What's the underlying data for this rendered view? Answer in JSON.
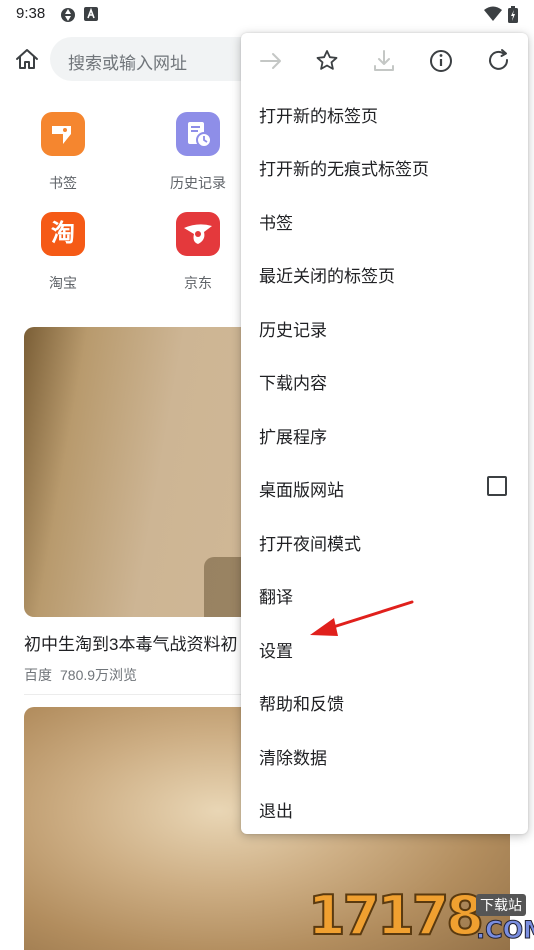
{
  "status_bar": {
    "time": "9:38",
    "icons": [
      "sync-icon",
      "a-box-icon",
      "wifi-icon",
      "battery-icon"
    ]
  },
  "omnibox": {
    "placeholder": "搜索或输入网址"
  },
  "shortcuts": [
    {
      "label": "书签",
      "icon": "bookmark-tile-icon",
      "color": "#f5862f"
    },
    {
      "label": "历史记录",
      "icon": "history-tile-icon",
      "color": "#8e8ee8"
    },
    {
      "label": "淘宝",
      "icon": "taobao-tile-icon",
      "color": "#f55a16",
      "glyph": "淘"
    },
    {
      "label": "京东",
      "icon": "jd-tile-icon",
      "color": "#e4393c"
    }
  ],
  "feed": {
    "card1": {
      "title": "初中生淘到3本毒气战资料初",
      "source": "百度",
      "views": "780.9万浏览"
    }
  },
  "menu": {
    "toolbar": [
      "forward-icon",
      "star-icon",
      "download-icon",
      "info-icon",
      "reload-icon"
    ],
    "items": [
      {
        "label": "打开新的标签页"
      },
      {
        "label": "打开新的无痕式标签页"
      },
      {
        "label": "书签"
      },
      {
        "label": "最近关闭的标签页"
      },
      {
        "label": "历史记录"
      },
      {
        "label": "下载内容"
      },
      {
        "label": "扩展程序"
      },
      {
        "label": "桌面版网站",
        "checkbox": false
      },
      {
        "label": "打开夜间模式"
      },
      {
        "label": "翻译"
      },
      {
        "label": "设置"
      },
      {
        "label": "帮助和反馈"
      },
      {
        "label": "清除数据"
      },
      {
        "label": "退出"
      }
    ]
  },
  "watermark": {
    "digits": "17178",
    "tag": "下载站",
    "domain": ".COM"
  },
  "colors": {
    "arrow": "#e0201c",
    "menu_bg": "#ffffff",
    "omnibox_bg": "#f1f3f4"
  }
}
